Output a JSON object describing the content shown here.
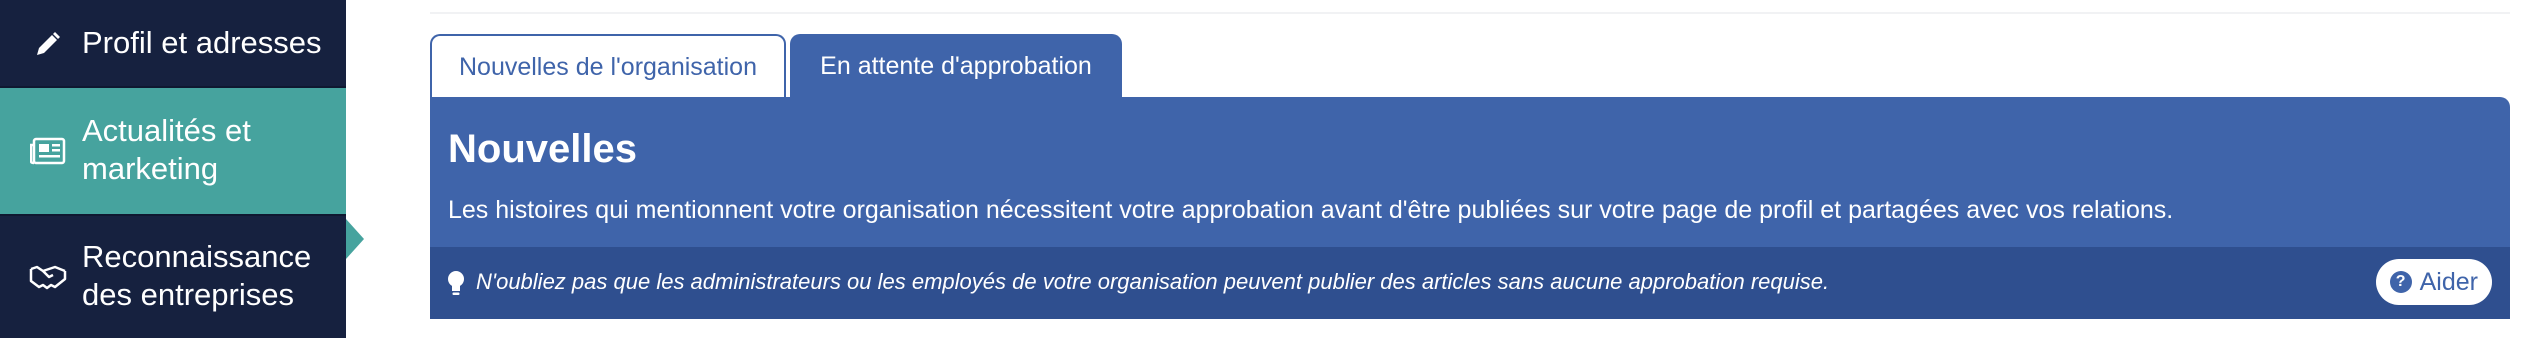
{
  "sidebar": {
    "items": [
      {
        "label": "Profil et adresses",
        "icon": "pencil-icon",
        "active": false
      },
      {
        "label": "Actualités et marketing",
        "icon": "newspaper-icon",
        "active": true
      },
      {
        "label": "Reconnaissance des entreprises",
        "icon": "handshake-icon",
        "active": false
      }
    ]
  },
  "tabs": [
    {
      "label": "Nouvelles de l'organisation",
      "selected": true
    },
    {
      "label": "En attente d'approbation",
      "selected": false
    }
  ],
  "panel": {
    "title": "Nouvelles",
    "description": "Les histoires qui mentionnent votre organisation nécessitent votre approbation avant d'être publiées sur votre page de profil et partagées avec vos relations.",
    "notice": {
      "icon": "lightbulb-icon",
      "text": "N'oubliez pas que les administrateurs ou les employés de votre organisation peuvent publier des articles sans aucune approbation requise."
    },
    "help_button": {
      "icon": "question-circle-icon",
      "label": "Aider"
    }
  },
  "colors": {
    "sidebar_bg": "#16213f",
    "sidebar_active": "#46a39e",
    "primary_blue": "#3f64aa",
    "notice_blue": "#2f4f8f"
  }
}
